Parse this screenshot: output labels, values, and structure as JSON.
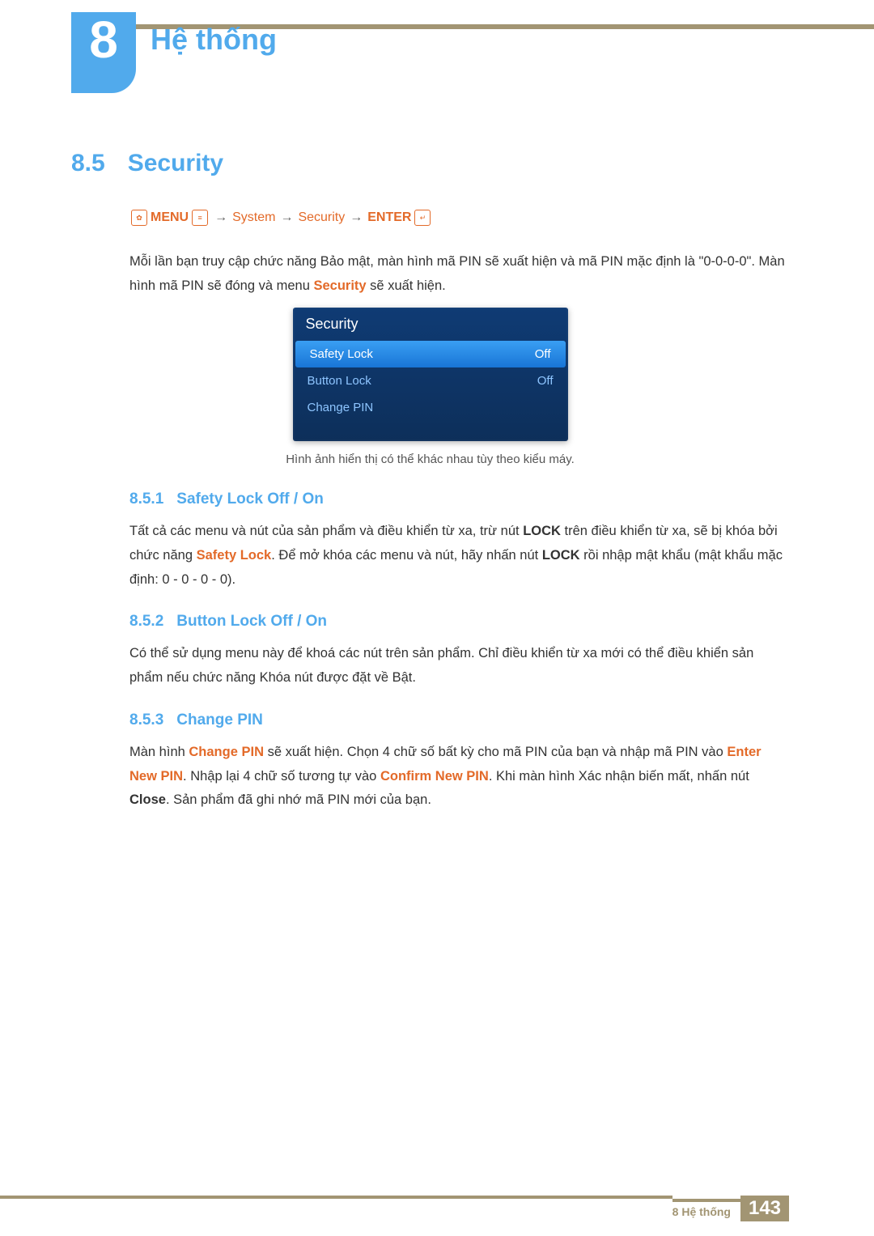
{
  "chapter": {
    "number": "8",
    "title": "Hệ thống"
  },
  "section": {
    "number": "8.5",
    "title": "Security"
  },
  "path": {
    "menu": "MENU",
    "sep": "→",
    "n1": "System",
    "n2": "Security",
    "enter": "ENTER"
  },
  "intro": {
    "part1": "Mỗi lần bạn truy cập chức năng Bảo mật, màn hình mã PIN sẽ xuất hiện và mã PIN mặc định là \"0-0-0-0\". Màn hình mã PIN sẽ đóng và menu ",
    "hl": "Security",
    "part2": " sẽ xuất hiện."
  },
  "panel": {
    "title": "Security",
    "rows": [
      {
        "label": "Safety Lock",
        "value": "Off"
      },
      {
        "label": "Button Lock",
        "value": "Off"
      },
      {
        "label": "Change PIN",
        "value": ""
      }
    ]
  },
  "caption": "Hình ảnh hiển thị có thể khác nhau tùy theo kiểu máy.",
  "s851": {
    "num": "8.5.1",
    "title": "Safety Lock Off / On",
    "p1a": "Tất cả các menu và nút của sản phẩm và điều khiển từ xa, trừ nút ",
    "b1": "LOCK",
    "p1b": " trên điều khiển từ xa, sẽ bị khóa bởi chức năng ",
    "hl": "Safety Lock",
    "p1c": ". Để mở khóa các menu và nút, hãy nhấn nút ",
    "b2": "LOCK",
    "p1d": " rồi nhập mật khẩu (mật khẩu mặc định: 0 - 0 - 0 - 0)."
  },
  "s852": {
    "num": "8.5.2",
    "title": "Button Lock Off / On",
    "p": "Có thể sử dụng menu này để khoá các nút trên sản phẩm. Chỉ điều khiển từ xa mới có thể điều khiển sản phẩm nếu chức năng Khóa nút được đặt về Bật."
  },
  "s853": {
    "num": "8.5.3",
    "title": "Change PIN",
    "p1a": "Màn hình ",
    "hl1": "Change PIN",
    "p1b": " sẽ xuất hiện. Chọn 4 chữ số bất kỳ cho mã PIN của bạn và nhập mã PIN vào ",
    "hl2": "Enter New PIN",
    "p1c": ". Nhập lại 4 chữ số tương tự vào ",
    "hl3": "Confirm New PIN",
    "p1d": ". Khi màn hình Xác nhận biến mất, nhấn nút ",
    "b1": "Close",
    "p1e": ". Sản phẩm đã ghi nhớ mã PIN mới của bạn."
  },
  "footer": {
    "text": "8 Hệ thống",
    "page": "143"
  }
}
